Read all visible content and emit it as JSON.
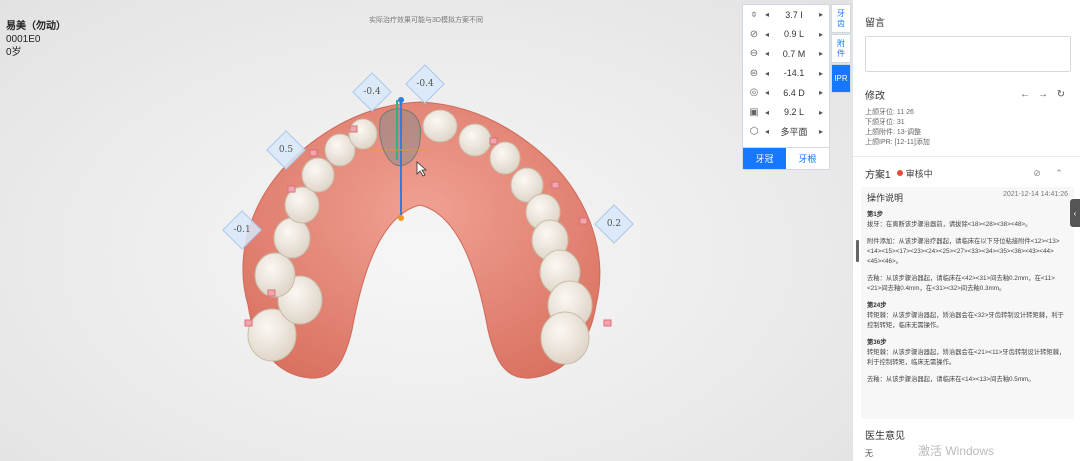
{
  "patient": {
    "name": "易美（勿动）",
    "id": "0001E0",
    "age": "0岁"
  },
  "viewport": {
    "notice": "实际治疗效果可能与3D模拟方案不同"
  },
  "ipr_tags": [
    "-0.4",
    "-0.4",
    "0.5",
    "-0.1",
    "0.2"
  ],
  "controls": {
    "rows": [
      {
        "icon": "rotation-icon",
        "glyph": "⌽",
        "value": "3.7 I"
      },
      {
        "icon": "angulation-icon",
        "glyph": "⊘",
        "value": "0.9 L"
      },
      {
        "icon": "torque-icon",
        "glyph": "⊖",
        "value": "0.7 M"
      },
      {
        "icon": "tip-icon",
        "glyph": "⊜",
        "value": "-14.1"
      },
      {
        "icon": "translation-icon",
        "glyph": "◎",
        "value": "6.4 D"
      },
      {
        "icon": "extrusion-icon",
        "glyph": "▣",
        "value": "9.2 L"
      },
      {
        "icon": "multiplane-icon",
        "glyph": "⬡",
        "value": "多平面"
      }
    ],
    "tab_crown": "牙冠",
    "tab_root": "牙根"
  },
  "side_tabs": [
    "牙齿",
    "附件",
    "IPR"
  ],
  "panel": {
    "comment_title": "留言",
    "modify_title": "修改",
    "modify_lines": [
      "上颌牙位: 11  26",
      "下颌牙位: 31",
      "上颌附件: 13-调整",
      "上颌IPR: [12-11]添加"
    ],
    "plan_name": "方案1",
    "plan_status": "审核中",
    "op_title": "操作说明",
    "op_time": "2021-12-14 14:41:26",
    "steps": [
      {
        "title": "第1步",
        "lines": [
          "拔牙：在离断该步骤治器前，请拔除<18><28><38><48>。"
        ]
      },
      {
        "title": "",
        "lines": [
          "附件添加：从该步骤治疗器起，请临床在以下牙位粘接附件<12><13><14><15><17><23><24><25><27><33><34><35><36><43><44><45><46>。"
        ]
      },
      {
        "title": "",
        "lines": [
          "去釉：从该步骤治器起，请临床在<42><31>间去釉0.2mm，在<11><21>间去釉0.4mm，在<31><32>间去釉0.3mm。"
        ]
      },
      {
        "title": "第24步",
        "lines": [
          "转矩棘：从该步骤治器起，矫治器会在<32>牙齿转制设计转矩棘，利于控制转矩，临床无需操作。"
        ]
      },
      {
        "title": "第36步",
        "lines": [
          "转矩棘：从该步骤治器起，矫治器会在<21><11>牙齿转制设计转矩棘，利于控制转矩，临床无需操作。"
        ]
      },
      {
        "title": "",
        "lines": [
          "去釉：从该步骤治器起，请临床在<14><13>间去釉0.5mm。"
        ]
      }
    ],
    "doctor_title": "医生意见",
    "doctor_text": "无"
  },
  "watermark": "激活 Windows",
  "colors": {
    "accent": "#1677ff",
    "status": "#e84b3c",
    "gum": "#e8897c",
    "tooth": "#f1ece4"
  }
}
